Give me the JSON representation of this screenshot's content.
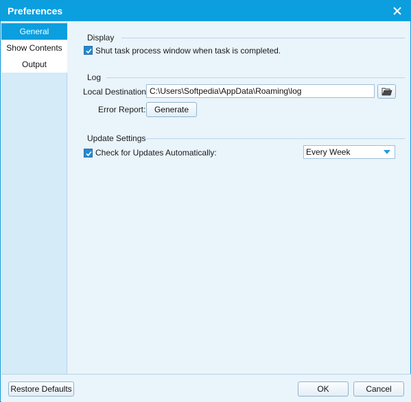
{
  "window": {
    "title": "Preferences",
    "accent_color": "#0b9fdf",
    "close_icon": "close-icon"
  },
  "sidebar": {
    "items": [
      {
        "label": "General",
        "active": true
      },
      {
        "label": "Show Contents",
        "active": false
      },
      {
        "label": "Output",
        "active": false
      }
    ]
  },
  "display": {
    "title": "Display",
    "shut_task_label": "Shut task process window when task is completed.",
    "shut_task_checked": true
  },
  "log": {
    "title": "Log",
    "local_destination_label": "Local Destination:",
    "local_destination_value": "C:\\Users\\Softpedia\\AppData\\Roaming\\log",
    "browse_icon": "folder-open-icon",
    "error_report_label": "Error Report:",
    "generate_label": "Generate"
  },
  "update": {
    "title": "Update Settings",
    "check_label": "Check for Updates Automatically:",
    "check_checked": true,
    "frequency_value": "Every Week"
  },
  "footer": {
    "restore_label": "Restore Defaults",
    "ok_label": "OK",
    "cancel_label": "Cancel"
  }
}
